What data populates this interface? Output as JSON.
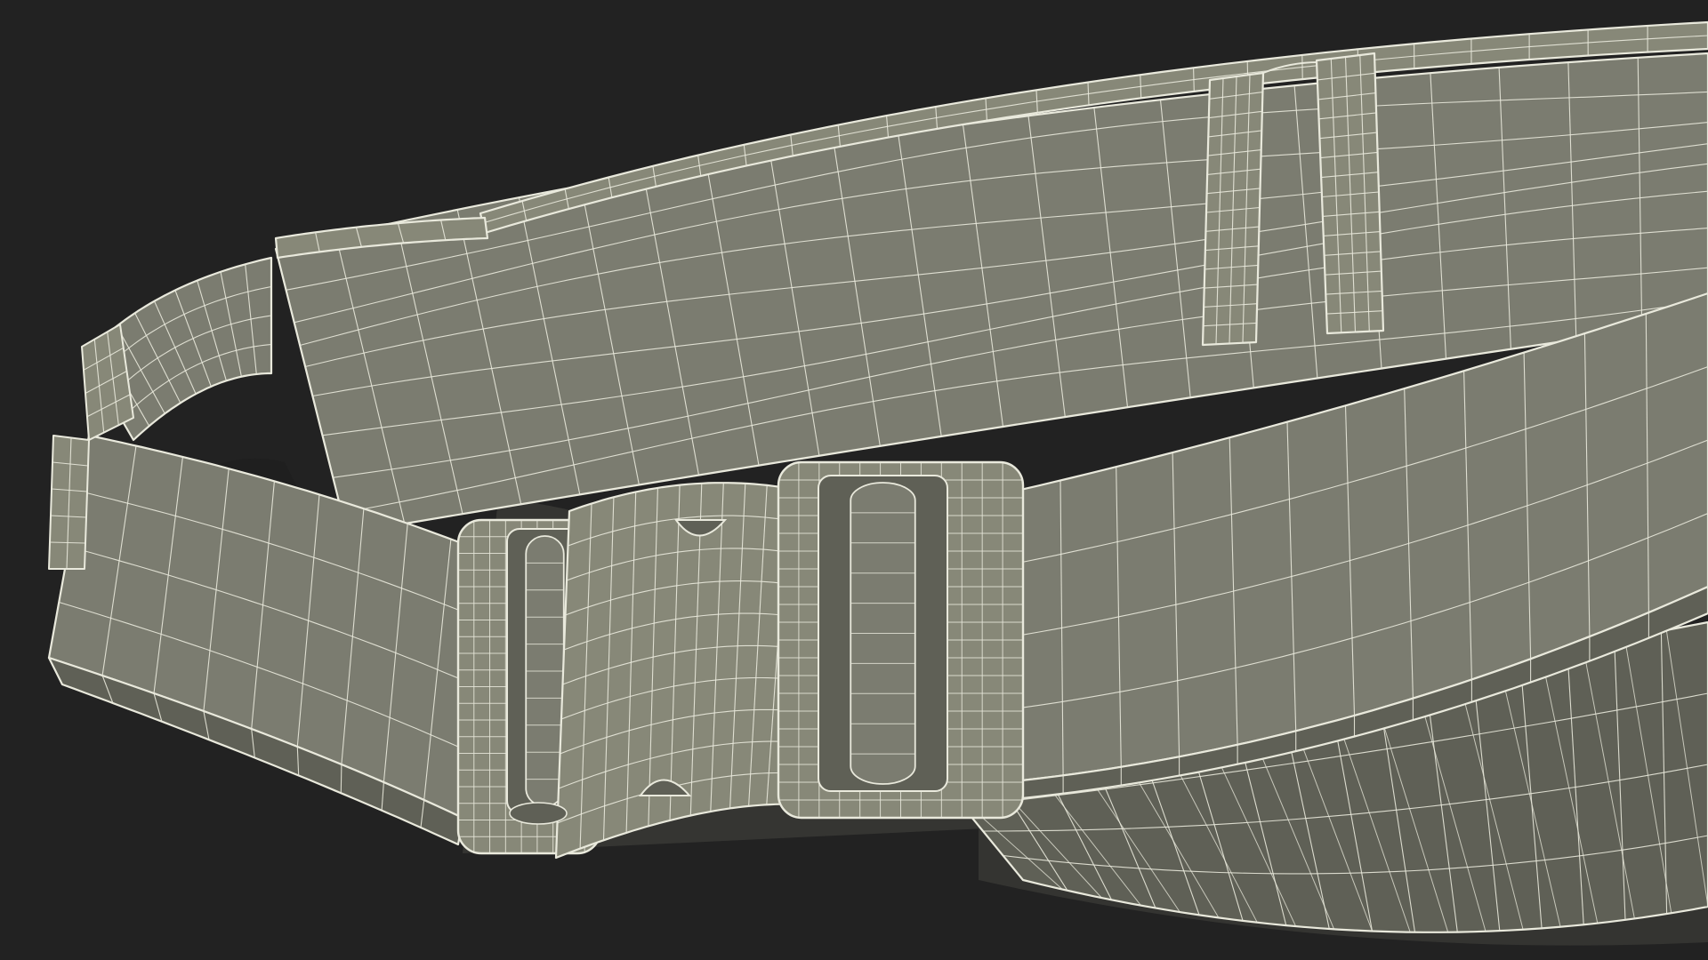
{
  "render": {
    "subject": "",
    "colors": {
      "background": "#222222",
      "surface": "#7b7c70",
      "surface_light": "#878878",
      "surface_dark": "#5f6056",
      "shadow": "#45463f",
      "wire": "#e9e9dc"
    },
    "wire_density": {
      "main_panel": [
        22,
        9
      ],
      "back_strap": [
        9,
        4
      ],
      "left_strap": [
        9,
        4
      ],
      "right_strap": [
        12,
        4
      ],
      "loop_a": [
        2,
        8
      ],
      "loop_b": [
        2,
        8
      ],
      "buckle": [
        12,
        10
      ],
      "frame_left": [
        3,
        10
      ],
      "frame_right": [
        4,
        10
      ],
      "lower_pouch": [
        16,
        4
      ]
    }
  }
}
